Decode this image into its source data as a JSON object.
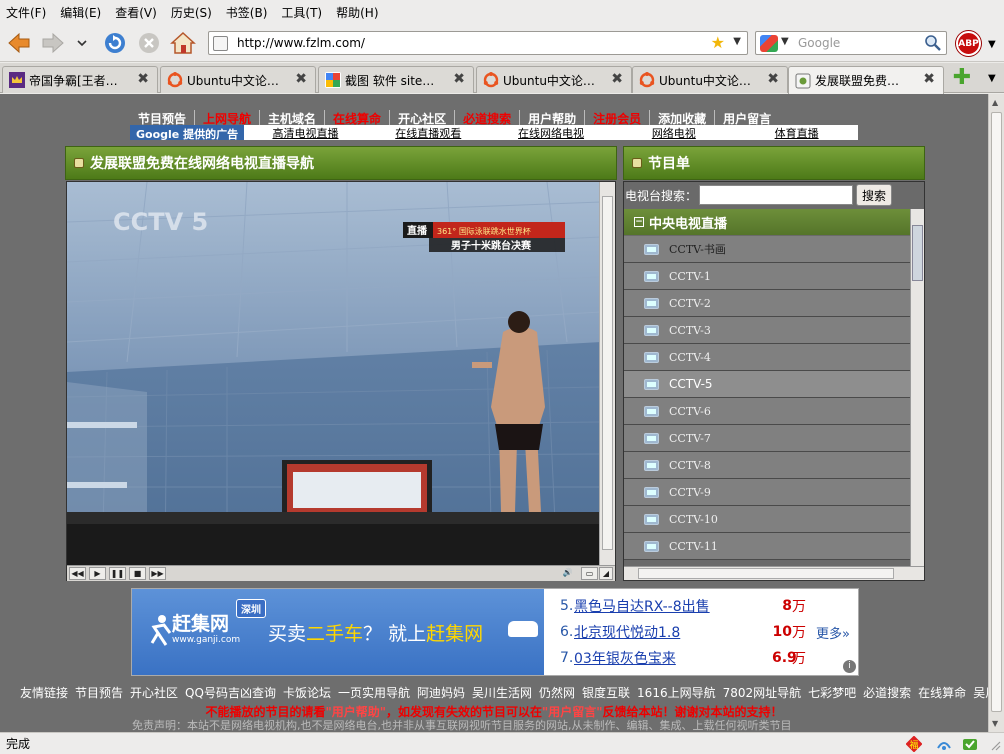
{
  "menubar": [
    "文件(F)",
    "编辑(E)",
    "查看(V)",
    "历史(S)",
    "书签(B)",
    "工具(T)",
    "帮助(H)"
  ],
  "navbar": {
    "url": "http://www.fzlm.com/",
    "search_placeholder": "Google",
    "abp_label": "ABP"
  },
  "tabs": [
    {
      "label": "帝国争霸[王者…",
      "icon": "crown-icon",
      "active": false
    },
    {
      "label": "Ubuntu中文论…",
      "icon": "ubuntu-icon",
      "active": false
    },
    {
      "label": "截图 软件 site…",
      "icon": "google-icon",
      "active": false
    },
    {
      "label": "Ubuntu中文论…",
      "icon": "ubuntu-icon",
      "active": false
    },
    {
      "label": "Ubuntu中文论…",
      "icon": "ubuntu-icon",
      "active": false
    },
    {
      "label": "发展联盟免费…",
      "icon": "page-icon",
      "active": true
    }
  ],
  "page": {
    "topnav": [
      {
        "label": "节目预告",
        "red": false
      },
      {
        "label": "上网导航",
        "red": true
      },
      {
        "label": "主机域名",
        "red": false
      },
      {
        "label": "在线算命",
        "red": true
      },
      {
        "label": "开心社区",
        "red": false
      },
      {
        "label": "必道搜索",
        "red": true
      },
      {
        "label": "用户帮助",
        "red": false
      },
      {
        "label": "注册会员",
        "red": true
      },
      {
        "label": "添加收藏",
        "red": false
      },
      {
        "label": "用户留言",
        "red": false
      }
    ],
    "ad_label": "Google 提供的广告",
    "ad_links": [
      "高清电视直播",
      "在线直播观看",
      "在线网络电视",
      "网络电视",
      "体育直播"
    ],
    "player_title": "发展联盟免费在线网络电视直播导航",
    "video": {
      "channel_logo": "CCTV 5",
      "live_tag": "直播",
      "event_banner": "361° 国际泳联跳水世界杯",
      "event_sub": "男子十米跳台决赛"
    },
    "guide": {
      "title": "节目单",
      "search_label": "电视台搜索：",
      "search_value": "",
      "search_button": "搜索",
      "category": "中央电视直播",
      "channels": [
        "CCTV-书画",
        "CCTV-1",
        "CCTV-2",
        "CCTV-3",
        "CCTV-4",
        "CCTV-5",
        "CCTV-6",
        "CCTV-7",
        "CCTV-8",
        "CCTV-9",
        "CCTV-10",
        "CCTV-11"
      ],
      "active_channel": "CCTV-5"
    },
    "banner": {
      "brand": "赶集网",
      "domain": "www.ganji.com",
      "city": "深圳",
      "slogan_a": "买卖",
      "slogan_b": "二手车",
      "slogan_c": "？ 就上",
      "slogan_d": "赶集网",
      "items": [
        {
          "num": "5.",
          "title": "黑色马自达RX--8出售",
          "price": "8",
          "unit": "万"
        },
        {
          "num": "6.",
          "title": "北京现代悦动1.8",
          "price": "10",
          "unit": "万"
        },
        {
          "num": "7.",
          "title": "03年银灰色宝来",
          "price": "6.9",
          "unit": "万"
        }
      ],
      "more": "更多»"
    },
    "friend_links": [
      "友情链接",
      "节目预告",
      "开心社区",
      "QQ号码吉凶查询",
      "卡饭论坛",
      "一页实用导航",
      "阿迪妈妈",
      "吴川生活网",
      "仍然网",
      "银度互联",
      "1616上网导航",
      "7802网址导航",
      "七彩梦吧",
      "必道搜索",
      "在线算命",
      "吴川商网"
    ],
    "notice_a": "不能播放的节目的请看",
    "notice_b": "\"用户帮助\"",
    "notice_c": "，如发现有失效的节目可以在",
    "notice_d": "\"用户留言\"",
    "notice_e": "反馈给本站！谢谢对本站的支持！",
    "disclaimer": "免责声明：本站不是网络电视机构,也不是网络电台,也并非从事互联网视听节目服务的网站,从未制作、编辑、集成、上载任何视听类节目"
  },
  "status": "完成",
  "colors": {
    "accent_green": "#5a8a1e",
    "content_bg": "#6e6e6e",
    "red_link": "#e00000"
  }
}
